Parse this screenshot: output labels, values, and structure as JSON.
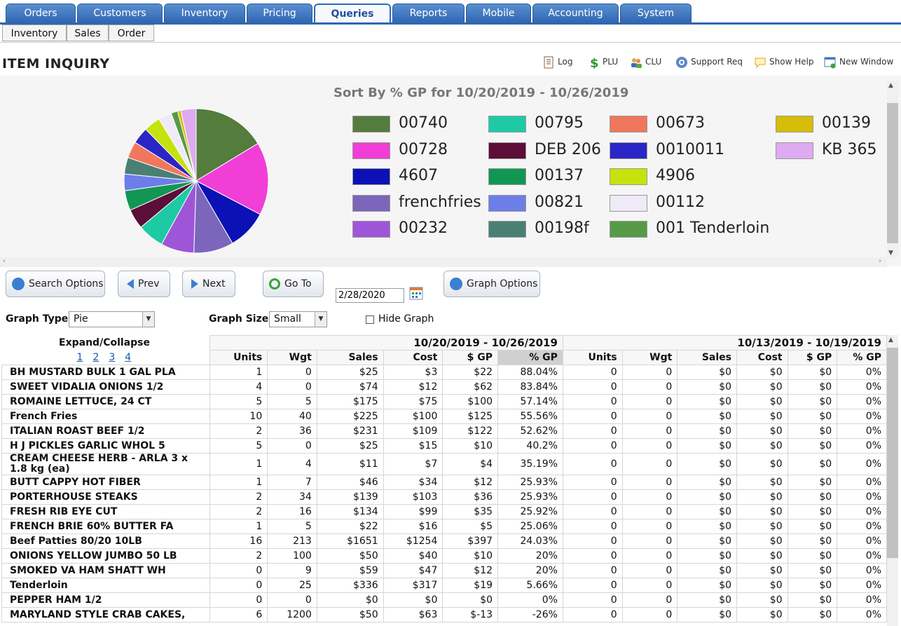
{
  "tabs": [
    {
      "label": "Orders"
    },
    {
      "label": "Customers"
    },
    {
      "label": "Inventory"
    },
    {
      "label": "Pricing"
    },
    {
      "label": "Queries"
    },
    {
      "label": "Reports"
    },
    {
      "label": "Mobile"
    },
    {
      "label": "Accounting"
    },
    {
      "label": "System"
    }
  ],
  "subtabs": [
    {
      "label": "Inventory"
    },
    {
      "label": "Sales"
    },
    {
      "label": "Order"
    }
  ],
  "page_title": "ITEM INQUIRY",
  "tools": {
    "log": "Log",
    "plu": "PLU",
    "clu": "CLU",
    "support": "Support Req",
    "help": "Show Help",
    "newwin": "New Window"
  },
  "chart_data": {
    "type": "pie",
    "title": "Sort By % GP for 10/20/2019 - 10/26/2019",
    "series": [
      {
        "name": "00740",
        "color": "#537c3d",
        "value": 22
      },
      {
        "name": "00728",
        "color": "#f03ed7",
        "value": 22
      },
      {
        "name": "4607",
        "color": "#0b11b4",
        "value": 12
      },
      {
        "name": "frenchfries",
        "color": "#7b66bb",
        "value": 12
      },
      {
        "name": "00232",
        "color": "#9f55d8",
        "value": 10
      },
      {
        "name": "00795",
        "color": "#1dcaa5",
        "value": 8
      },
      {
        "name": "DEB 206",
        "color": "#5c0d38",
        "value": 6
      },
      {
        "name": "00137",
        "color": "#129653",
        "value": 6
      },
      {
        "name": "00821",
        "color": "#6e7ee8",
        "value": 5
      },
      {
        "name": "00198f",
        "color": "#4a8074",
        "value": 5
      },
      {
        "name": "00673",
        "color": "#f0775c",
        "value": 5
      },
      {
        "name": "0010011",
        "color": "#2a26c6",
        "value": 5
      },
      {
        "name": "4906",
        "color": "#c6e20c",
        "value": 5
      },
      {
        "name": "00112",
        "color": "#eeeaf7",
        "value": 4
      },
      {
        "name": "001 Tenderloin",
        "color": "#579a46",
        "value": 2
      },
      {
        "name": "00139",
        "color": "#d6bd08",
        "value": 1
      },
      {
        "name": "KB 365",
        "color": "#deaaf2",
        "value": 4.6
      }
    ]
  },
  "buttons": {
    "search": "Search Options",
    "prev": "Prev",
    "next": "Next",
    "goto": "Go To",
    "graph_options": "Graph Options"
  },
  "date_value": "2/28/2020",
  "controls": {
    "graph_type_label": "Graph Type",
    "graph_type_value": "Pie",
    "graph_size_label": "Graph Size",
    "graph_size_value": "Small",
    "hide_graph_label": "Hide Graph"
  },
  "table": {
    "expand_collapse": "Expand/Collapse",
    "pages": [
      "1",
      "2",
      "3",
      "4"
    ],
    "range1": "10/20/2019 - 10/26/2019",
    "range2": "10/13/2019 - 10/19/2019",
    "columns": [
      "Units",
      "Wgt",
      "Sales",
      "Cost",
      "$ GP",
      "% GP"
    ],
    "rows": [
      {
        "name": "BH MUSTARD BULK 1 GAL PLA",
        "a": [
          "1",
          "0",
          "$25",
          "$3",
          "$22",
          "88.04%"
        ],
        "b": [
          "0",
          "0",
          "$0",
          "$0",
          "$0",
          "0%"
        ]
      },
      {
        "name": "SWEET VIDALIA ONIONS 1/2",
        "a": [
          "4",
          "0",
          "$74",
          "$12",
          "$62",
          "83.84%"
        ],
        "b": [
          "0",
          "0",
          "$0",
          "$0",
          "$0",
          "0%"
        ]
      },
      {
        "name": "ROMAINE LETTUCE, 24 CT",
        "a": [
          "5",
          "5",
          "$175",
          "$75",
          "$100",
          "57.14%"
        ],
        "b": [
          "0",
          "0",
          "$0",
          "$0",
          "$0",
          "0%"
        ]
      },
      {
        "name": "French Fries",
        "a": [
          "10",
          "40",
          "$225",
          "$100",
          "$125",
          "55.56%"
        ],
        "b": [
          "0",
          "0",
          "$0",
          "$0",
          "$0",
          "0%"
        ]
      },
      {
        "name": "ITALIAN ROAST BEEF 1/2",
        "a": [
          "2",
          "36",
          "$231",
          "$109",
          "$122",
          "52.62%"
        ],
        "b": [
          "0",
          "0",
          "$0",
          "$0",
          "$0",
          "0%"
        ]
      },
      {
        "name": "H J PICKLES GARLIC WHOL 5",
        "a": [
          "5",
          "0",
          "$25",
          "$15",
          "$10",
          "40.2%"
        ],
        "b": [
          "0",
          "0",
          "$0",
          "$0",
          "$0",
          "0%"
        ]
      },
      {
        "name": "CREAM CHEESE HERB - ARLA 3 x 1.8 kg (ea)",
        "a": [
          "1",
          "4",
          "$11",
          "$7",
          "$4",
          "35.19%"
        ],
        "b": [
          "0",
          "0",
          "$0",
          "$0",
          "$0",
          "0%"
        ]
      },
      {
        "name": "BUTT CAPPY HOT FIBER",
        "a": [
          "1",
          "7",
          "$46",
          "$34",
          "$12",
          "25.93%"
        ],
        "b": [
          "0",
          "0",
          "$0",
          "$0",
          "$0",
          "0%"
        ]
      },
      {
        "name": "PORTERHOUSE STEAKS",
        "a": [
          "2",
          "34",
          "$139",
          "$103",
          "$36",
          "25.93%"
        ],
        "b": [
          "0",
          "0",
          "$0",
          "$0",
          "$0",
          "0%"
        ]
      },
      {
        "name": "FRESH RIB EYE CUT",
        "a": [
          "2",
          "16",
          "$134",
          "$99",
          "$35",
          "25.92%"
        ],
        "b": [
          "0",
          "0",
          "$0",
          "$0",
          "$0",
          "0%"
        ]
      },
      {
        "name": "FRENCH BRIE 60% BUTTER FA",
        "a": [
          "1",
          "5",
          "$22",
          "$16",
          "$5",
          "25.06%"
        ],
        "b": [
          "0",
          "0",
          "$0",
          "$0",
          "$0",
          "0%"
        ]
      },
      {
        "name": "Beef Patties 80/20 10LB",
        "a": [
          "16",
          "213",
          "$1651",
          "$1254",
          "$397",
          "24.03%"
        ],
        "b": [
          "0",
          "0",
          "$0",
          "$0",
          "$0",
          "0%"
        ]
      },
      {
        "name": "ONIONS YELLOW JUMBO 50 LB",
        "a": [
          "2",
          "100",
          "$50",
          "$40",
          "$10",
          "20%"
        ],
        "b": [
          "0",
          "0",
          "$0",
          "$0",
          "$0",
          "0%"
        ]
      },
      {
        "name": "SMOKED VA HAM SHATT WH",
        "a": [
          "0",
          "9",
          "$59",
          "$47",
          "$12",
          "20%"
        ],
        "b": [
          "0",
          "0",
          "$0",
          "$0",
          "$0",
          "0%"
        ]
      },
      {
        "name": "Tenderloin",
        "a": [
          "0",
          "25",
          "$336",
          "$317",
          "$19",
          "5.66%"
        ],
        "b": [
          "0",
          "0",
          "$0",
          "$0",
          "$0",
          "0%"
        ]
      },
      {
        "name": "PEPPER HAM 1/2",
        "a": [
          "0",
          "0",
          "$0",
          "$0",
          "$0",
          "0%"
        ],
        "b": [
          "0",
          "0",
          "$0",
          "$0",
          "$0",
          "0%"
        ]
      },
      {
        "name": "MARYLAND STYLE CRAB CAKES,",
        "a": [
          "6",
          "1200",
          "$50",
          "$63",
          "$-13",
          "-26%"
        ],
        "b": [
          "0",
          "0",
          "$0",
          "$0",
          "$0",
          "0%"
        ]
      }
    ]
  }
}
